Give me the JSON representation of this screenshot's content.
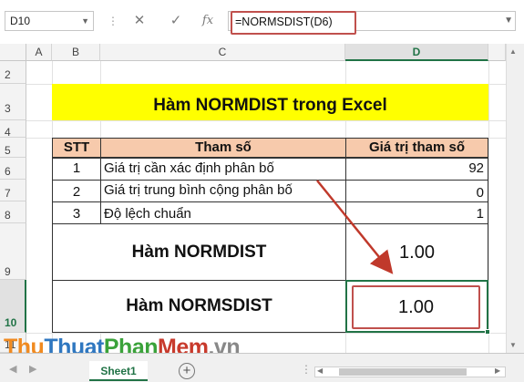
{
  "formula_bar": {
    "name_box": "D10",
    "cancel_icon": "✕",
    "enter_icon": "✓",
    "fx_label": "fx",
    "formula": "=NORMSDIST(D6)"
  },
  "columns": [
    "A",
    "B",
    "C",
    "D"
  ],
  "rows": [
    "2",
    "3",
    "4",
    "5",
    "6",
    "7",
    "8",
    "9",
    "10",
    "11"
  ],
  "sheet": {
    "title": "Hàm NORMDIST trong Excel",
    "headers": {
      "stt": "STT",
      "param": "Tham số",
      "value": "Giá trị tham số"
    },
    "params": [
      {
        "stt": "1",
        "label": "Giá trị cần xác định phân bố",
        "value": "92"
      },
      {
        "stt": "2",
        "label": "Giá trị trung bình cộng phân bố",
        "value": "0"
      },
      {
        "stt": "3",
        "label": "Độ lệch chuẩn",
        "value": "1"
      }
    ],
    "normdist": {
      "label": "Hàm NORMDIST",
      "value": "1.00"
    },
    "normsdist": {
      "label": "Hàm NORMSDIST",
      "value": "1.00"
    }
  },
  "tabs": {
    "active": "Sheet1",
    "add_label": "+"
  },
  "watermark": {
    "p1": "Thu",
    "p2": "Thuat",
    "p3": "Phan",
    "p4": "Mem",
    "p5": ".vn"
  },
  "colors": {
    "excel_green": "#217346",
    "header_fill": "#f7caac",
    "title_fill": "#ffff00",
    "highlight_red": "#c0504d"
  }
}
